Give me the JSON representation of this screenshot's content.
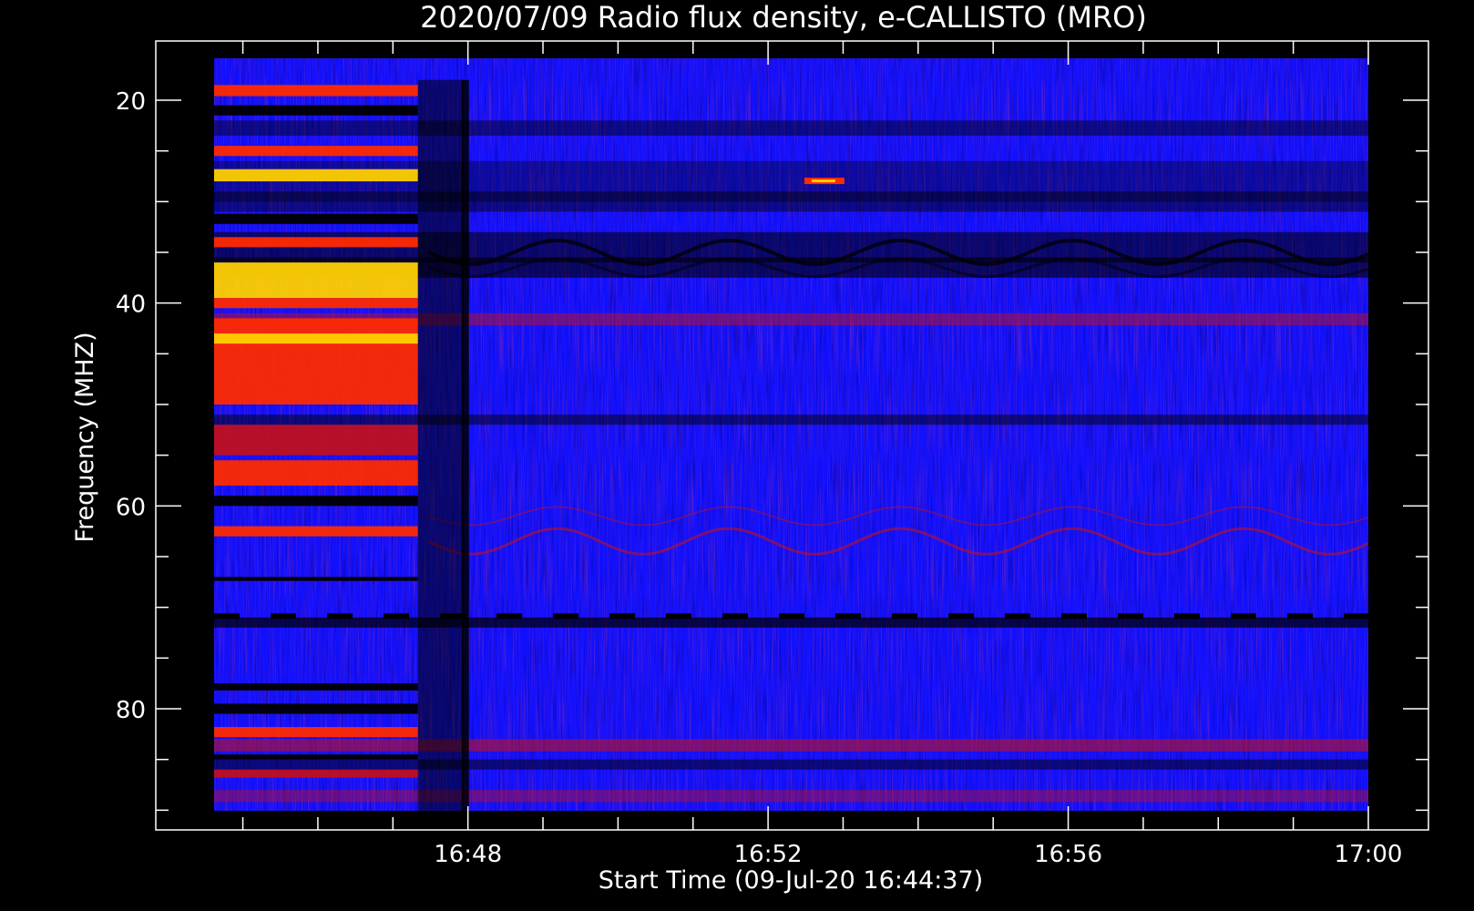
{
  "chart_data": {
    "type": "heatmap",
    "title": "2020/07/09  Radio flux density, e-CALLISTO (MRO)",
    "xlabel": "Start Time (09-Jul-20 16:44:37)",
    "ylabel": "Frequency (MHZ)",
    "x_range": [
      "16:44:37",
      "17:00:00"
    ],
    "y_range_mhz": [
      15,
      90
    ],
    "y_inverted": true,
    "x_ticks": [
      "16:48",
      "16:52",
      "16:56",
      "17:00"
    ],
    "y_ticks": [
      "20",
      "40",
      "60",
      "80"
    ],
    "colormap": [
      "#000000",
      "#1010ff",
      "#c01020",
      "#ff2a00",
      "#ffd000"
    ],
    "features": [
      {
        "name": "burst",
        "time_range": [
          "16:44:37",
          "16:47:20"
        ],
        "freq_range_mhz": [
          18,
          90
        ],
        "intensity": "high"
      },
      {
        "name": "narrowband emission",
        "time": "16:52:45",
        "freq_mhz": 28,
        "intensity": "medium"
      }
    ]
  }
}
